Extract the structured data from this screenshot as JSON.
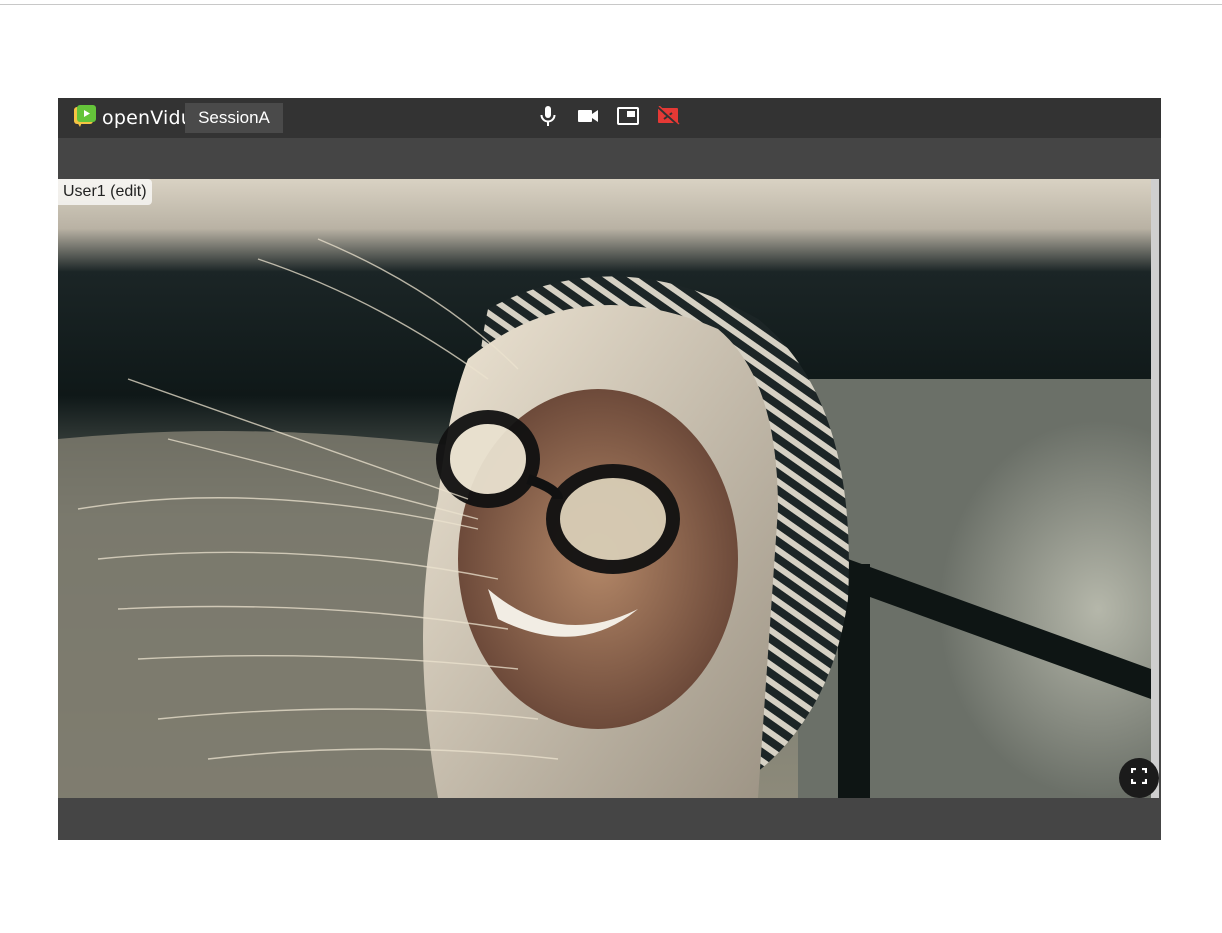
{
  "app": {
    "logo_text": "openVidu",
    "session_name": "SessionA"
  },
  "toolbar": {
    "icons": [
      "microphone-icon",
      "camera-icon",
      "screen-share-icon",
      "camera-off-icon"
    ],
    "colors": {
      "bar": "#333333",
      "danger": "#e53935",
      "logo_green": "#65c43a",
      "logo_yellow": "#f6c343"
    }
  },
  "stream": {
    "nickname": "User1 (edit)"
  },
  "controls": {
    "fullscreen_icon": "fullscreen-icon"
  }
}
